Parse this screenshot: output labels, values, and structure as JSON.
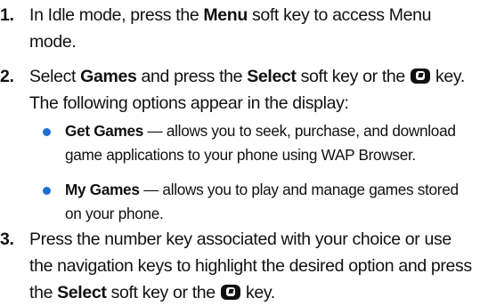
{
  "accent_color": "#1f6fd1",
  "steps": [
    {
      "number": "1.",
      "text_before": "In Idle mode, press the ",
      "bold1": "Menu",
      "text_after": " soft key to access Menu mode."
    },
    {
      "number": "2.",
      "text_before": "Select ",
      "bold1": "Games",
      "text_mid": " and press the ",
      "bold2": "Select",
      "text_after_1": " soft key or the ",
      "icon": "ok-key-icon",
      "text_after_2": " key. The following options appear in the display:"
    },
    {
      "number": "3.",
      "text_before": "Press the number key associated with your choice or use the navigation keys to highlight the desired option and press the ",
      "bold1": "Select",
      "text_after_1": " soft key or the ",
      "icon": "ok-key-icon",
      "text_after_2": " key."
    }
  ],
  "bullets": [
    {
      "title": "Get Games",
      "text": " — allows you to seek, purchase, and download game applications to your phone using WAP Browser."
    },
    {
      "title": "My Games",
      "text": " — allows you to play and manage games stored on your phone."
    }
  ]
}
